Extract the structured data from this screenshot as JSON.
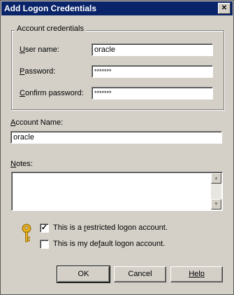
{
  "window": {
    "title": "Add Logon Credentials",
    "close_glyph": "✕"
  },
  "account_credentials": {
    "group_label": "Account credentials",
    "user_name": {
      "label_u": "U",
      "label_rest": "ser name:",
      "value": "oracle"
    },
    "password": {
      "label_u": "P",
      "label_rest": "assword:",
      "value": "*******"
    },
    "confirm_password": {
      "label_u": "C",
      "label_rest": "onfirm password:",
      "value": "*******"
    }
  },
  "account_name": {
    "label_u": "A",
    "label_rest": "ccount Name:",
    "value": "oracle"
  },
  "notes": {
    "label_u": "N",
    "label_rest": "otes:",
    "value": "",
    "scroll_up": "▲",
    "scroll_down": "▼"
  },
  "options": {
    "restricted": {
      "checked": true,
      "mark": "✓",
      "pre": "This is a ",
      "u": "r",
      "post": "estricted logon account."
    },
    "default": {
      "checked": false,
      "mark": "",
      "pre": "This is my de",
      "u": "f",
      "post": "ault logon account."
    }
  },
  "buttons": {
    "ok": "OK",
    "cancel": "Cancel",
    "help": "Help"
  },
  "icons": {
    "key": "key-icon"
  }
}
